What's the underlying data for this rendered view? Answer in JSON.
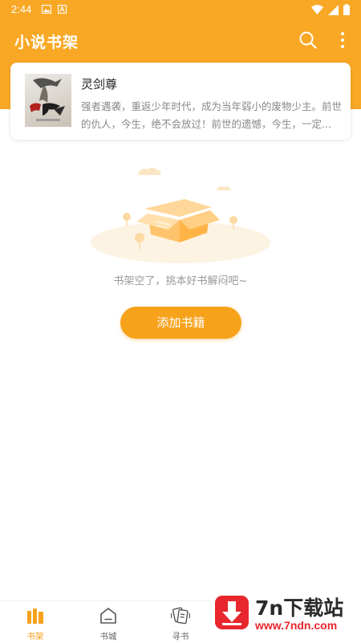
{
  "status_bar": {
    "time": "2:44",
    "left_icons": [
      "image-icon",
      "font-a-icon"
    ],
    "right_icons": [
      "wifi-icon",
      "signal-icon",
      "battery-icon"
    ]
  },
  "header": {
    "title": "小说书架",
    "background_color": "#f9a825",
    "actions": [
      "search-icon",
      "more-vert-icon"
    ]
  },
  "shelf": {
    "books": [
      {
        "title": "灵剑尊",
        "description": "强者遇袭，重返少年时代，成为当年弱小的废物少主。前世的仇人，今生，绝不会放过！前世的遗憾，今生，一定..."
      }
    ]
  },
  "empty_state": {
    "message": "书架空了，挑本好书解闷吧~",
    "illustration_icon": "empty-box-icon"
  },
  "add_button": {
    "label": "添加书籍",
    "color": "#f7a21b"
  },
  "bottom_nav": {
    "active_color": "#f7a21b",
    "items": [
      {
        "label": "书架",
        "icon": "bookshelf-icon",
        "active": true
      },
      {
        "label": "书城",
        "icon": "home-icon",
        "active": false
      },
      {
        "label": "寻书",
        "icon": "find-book-icon",
        "active": false
      }
    ]
  },
  "watermark": {
    "brand": "7n下载站",
    "url": "www.7ndn.com"
  }
}
